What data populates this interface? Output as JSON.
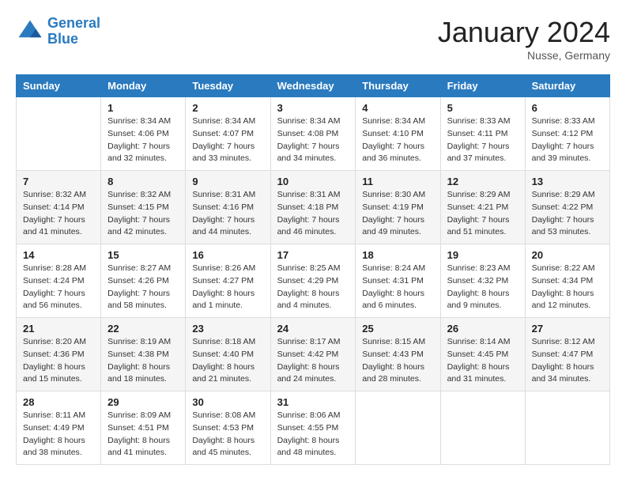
{
  "header": {
    "logo_line1": "General",
    "logo_line2": "Blue",
    "month_title": "January 2024",
    "location": "Nusse, Germany"
  },
  "days_of_week": [
    "Sunday",
    "Monday",
    "Tuesday",
    "Wednesday",
    "Thursday",
    "Friday",
    "Saturday"
  ],
  "weeks": [
    [
      {
        "day": "",
        "sunrise": "",
        "sunset": "",
        "daylight": ""
      },
      {
        "day": "1",
        "sunrise": "Sunrise: 8:34 AM",
        "sunset": "Sunset: 4:06 PM",
        "daylight": "Daylight: 7 hours and 32 minutes."
      },
      {
        "day": "2",
        "sunrise": "Sunrise: 8:34 AM",
        "sunset": "Sunset: 4:07 PM",
        "daylight": "Daylight: 7 hours and 33 minutes."
      },
      {
        "day": "3",
        "sunrise": "Sunrise: 8:34 AM",
        "sunset": "Sunset: 4:08 PM",
        "daylight": "Daylight: 7 hours and 34 minutes."
      },
      {
        "day": "4",
        "sunrise": "Sunrise: 8:34 AM",
        "sunset": "Sunset: 4:10 PM",
        "daylight": "Daylight: 7 hours and 36 minutes."
      },
      {
        "day": "5",
        "sunrise": "Sunrise: 8:33 AM",
        "sunset": "Sunset: 4:11 PM",
        "daylight": "Daylight: 7 hours and 37 minutes."
      },
      {
        "day": "6",
        "sunrise": "Sunrise: 8:33 AM",
        "sunset": "Sunset: 4:12 PM",
        "daylight": "Daylight: 7 hours and 39 minutes."
      }
    ],
    [
      {
        "day": "7",
        "sunrise": "Sunrise: 8:32 AM",
        "sunset": "Sunset: 4:14 PM",
        "daylight": "Daylight: 7 hours and 41 minutes."
      },
      {
        "day": "8",
        "sunrise": "Sunrise: 8:32 AM",
        "sunset": "Sunset: 4:15 PM",
        "daylight": "Daylight: 7 hours and 42 minutes."
      },
      {
        "day": "9",
        "sunrise": "Sunrise: 8:31 AM",
        "sunset": "Sunset: 4:16 PM",
        "daylight": "Daylight: 7 hours and 44 minutes."
      },
      {
        "day": "10",
        "sunrise": "Sunrise: 8:31 AM",
        "sunset": "Sunset: 4:18 PM",
        "daylight": "Daylight: 7 hours and 46 minutes."
      },
      {
        "day": "11",
        "sunrise": "Sunrise: 8:30 AM",
        "sunset": "Sunset: 4:19 PM",
        "daylight": "Daylight: 7 hours and 49 minutes."
      },
      {
        "day": "12",
        "sunrise": "Sunrise: 8:29 AM",
        "sunset": "Sunset: 4:21 PM",
        "daylight": "Daylight: 7 hours and 51 minutes."
      },
      {
        "day": "13",
        "sunrise": "Sunrise: 8:29 AM",
        "sunset": "Sunset: 4:22 PM",
        "daylight": "Daylight: 7 hours and 53 minutes."
      }
    ],
    [
      {
        "day": "14",
        "sunrise": "Sunrise: 8:28 AM",
        "sunset": "Sunset: 4:24 PM",
        "daylight": "Daylight: 7 hours and 56 minutes."
      },
      {
        "day": "15",
        "sunrise": "Sunrise: 8:27 AM",
        "sunset": "Sunset: 4:26 PM",
        "daylight": "Daylight: 7 hours and 58 minutes."
      },
      {
        "day": "16",
        "sunrise": "Sunrise: 8:26 AM",
        "sunset": "Sunset: 4:27 PM",
        "daylight": "Daylight: 8 hours and 1 minute."
      },
      {
        "day": "17",
        "sunrise": "Sunrise: 8:25 AM",
        "sunset": "Sunset: 4:29 PM",
        "daylight": "Daylight: 8 hours and 4 minutes."
      },
      {
        "day": "18",
        "sunrise": "Sunrise: 8:24 AM",
        "sunset": "Sunset: 4:31 PM",
        "daylight": "Daylight: 8 hours and 6 minutes."
      },
      {
        "day": "19",
        "sunrise": "Sunrise: 8:23 AM",
        "sunset": "Sunset: 4:32 PM",
        "daylight": "Daylight: 8 hours and 9 minutes."
      },
      {
        "day": "20",
        "sunrise": "Sunrise: 8:22 AM",
        "sunset": "Sunset: 4:34 PM",
        "daylight": "Daylight: 8 hours and 12 minutes."
      }
    ],
    [
      {
        "day": "21",
        "sunrise": "Sunrise: 8:20 AM",
        "sunset": "Sunset: 4:36 PM",
        "daylight": "Daylight: 8 hours and 15 minutes."
      },
      {
        "day": "22",
        "sunrise": "Sunrise: 8:19 AM",
        "sunset": "Sunset: 4:38 PM",
        "daylight": "Daylight: 8 hours and 18 minutes."
      },
      {
        "day": "23",
        "sunrise": "Sunrise: 8:18 AM",
        "sunset": "Sunset: 4:40 PM",
        "daylight": "Daylight: 8 hours and 21 minutes."
      },
      {
        "day": "24",
        "sunrise": "Sunrise: 8:17 AM",
        "sunset": "Sunset: 4:42 PM",
        "daylight": "Daylight: 8 hours and 24 minutes."
      },
      {
        "day": "25",
        "sunrise": "Sunrise: 8:15 AM",
        "sunset": "Sunset: 4:43 PM",
        "daylight": "Daylight: 8 hours and 28 minutes."
      },
      {
        "day": "26",
        "sunrise": "Sunrise: 8:14 AM",
        "sunset": "Sunset: 4:45 PM",
        "daylight": "Daylight: 8 hours and 31 minutes."
      },
      {
        "day": "27",
        "sunrise": "Sunrise: 8:12 AM",
        "sunset": "Sunset: 4:47 PM",
        "daylight": "Daylight: 8 hours and 34 minutes."
      }
    ],
    [
      {
        "day": "28",
        "sunrise": "Sunrise: 8:11 AM",
        "sunset": "Sunset: 4:49 PM",
        "daylight": "Daylight: 8 hours and 38 minutes."
      },
      {
        "day": "29",
        "sunrise": "Sunrise: 8:09 AM",
        "sunset": "Sunset: 4:51 PM",
        "daylight": "Daylight: 8 hours and 41 minutes."
      },
      {
        "day": "30",
        "sunrise": "Sunrise: 8:08 AM",
        "sunset": "Sunset: 4:53 PM",
        "daylight": "Daylight: 8 hours and 45 minutes."
      },
      {
        "day": "31",
        "sunrise": "Sunrise: 8:06 AM",
        "sunset": "Sunset: 4:55 PM",
        "daylight": "Daylight: 8 hours and 48 minutes."
      },
      {
        "day": "",
        "sunrise": "",
        "sunset": "",
        "daylight": ""
      },
      {
        "day": "",
        "sunrise": "",
        "sunset": "",
        "daylight": ""
      },
      {
        "day": "",
        "sunrise": "",
        "sunset": "",
        "daylight": ""
      }
    ]
  ]
}
